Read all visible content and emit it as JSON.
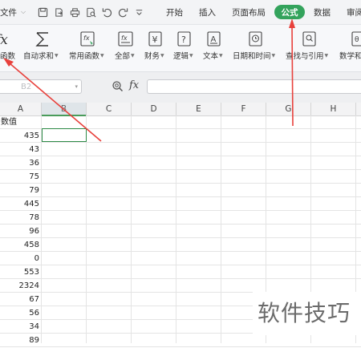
{
  "menubar": {
    "file_label": "文件",
    "tabs": [
      "开始",
      "插入",
      "页面布局",
      "公式",
      "数据",
      "审阅"
    ],
    "active_tab": "公式",
    "active_color": "#33a35c"
  },
  "ribbon": {
    "items": [
      {
        "label": "函数",
        "icon": "fx-insert-function-icon"
      },
      {
        "label": "自动求和",
        "icon": "sigma-icon"
      },
      {
        "label": "常用函数",
        "icon": "common-functions-icon"
      },
      {
        "label": "全部",
        "icon": "all-functions-icon"
      },
      {
        "label": "财务",
        "icon": "finance-icon"
      },
      {
        "label": "逻辑",
        "icon": "logic-icon"
      },
      {
        "label": "文本",
        "icon": "text-function-icon"
      },
      {
        "label": "日期和时间",
        "icon": "date-time-icon"
      },
      {
        "label": "查找与引用",
        "icon": "lookup-reference-icon"
      },
      {
        "label": "数学和",
        "icon": "math-trig-icon"
      }
    ]
  },
  "formula_bar": {
    "name_box": "B2",
    "fx_label": "fx",
    "content": ""
  },
  "sheet": {
    "columns": [
      "A",
      "B",
      "C",
      "D",
      "E",
      "F",
      "G",
      "H"
    ],
    "active_column": "B",
    "selected_cell": "B2",
    "column_a": [
      "数值",
      "435",
      "43",
      "36",
      "75",
      "79",
      "445",
      "78",
      "96",
      "458",
      "0",
      "553",
      "2324",
      "67",
      "56",
      "34",
      "89"
    ]
  },
  "watermark": "软件技巧",
  "annotation_color": "#e8413c"
}
